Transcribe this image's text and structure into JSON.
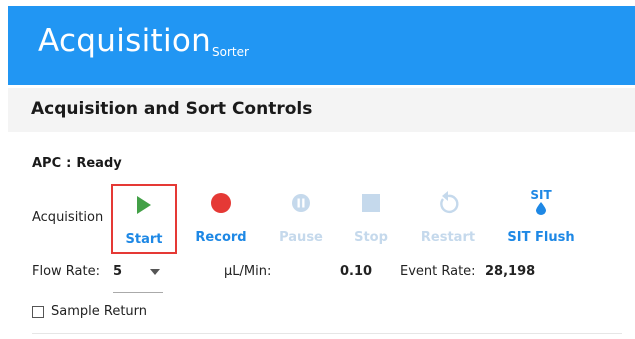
{
  "header": {
    "title": "Acquisition",
    "subtitle": "Sorter",
    "background_color": "#2196f3"
  },
  "section": {
    "title": "Acquisition and Sort Controls"
  },
  "status": {
    "instrument": "APC",
    "separator": ":",
    "state": "Ready"
  },
  "acquisition": {
    "label": "Acquisition",
    "controls": [
      {
        "label": "Start",
        "icon": "play-icon",
        "enabled": true,
        "highlighted": true
      },
      {
        "label": "Record",
        "icon": "record-icon",
        "enabled": true,
        "highlighted": false
      },
      {
        "label": "Pause",
        "icon": "pause-icon",
        "enabled": false,
        "highlighted": false
      },
      {
        "label": "Stop",
        "icon": "stop-icon",
        "enabled": false,
        "highlighted": false
      },
      {
        "label": "Restart",
        "icon": "restart-icon",
        "enabled": false,
        "highlighted": false
      },
      {
        "label": "SIT Flush",
        "icon": "sit-flush-icon",
        "icon_text": "SIT",
        "enabled": true,
        "highlighted": false
      }
    ]
  },
  "flow": {
    "rate_label": "Flow Rate:",
    "rate_value": "5",
    "ul_label": "µL/Min:",
    "ul_value": "0.10",
    "event_rate_label": "Event Rate:",
    "event_rate_value": "28,198"
  },
  "sample_return": {
    "label": "Sample Return",
    "checked": false
  },
  "colors": {
    "accent": "#1e88e5",
    "disabled": "#c5d9ec",
    "play": "#43a047",
    "record": "#e53935",
    "highlight_border": "#e53935"
  }
}
